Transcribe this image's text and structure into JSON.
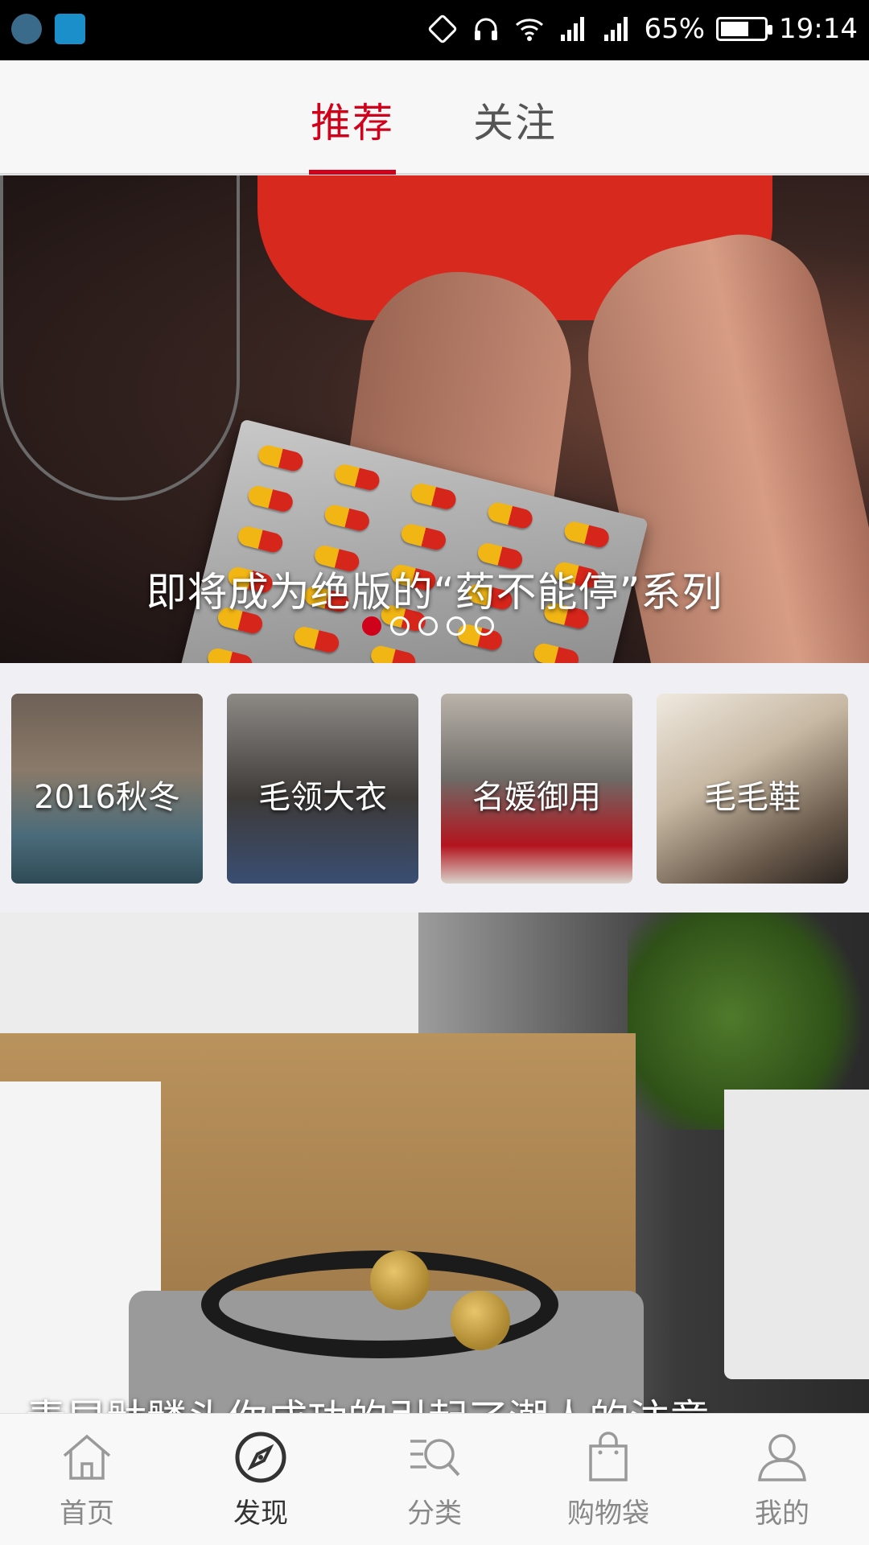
{
  "status_bar": {
    "battery": "65%",
    "time": "19:14",
    "battery_level": 0.65,
    "icons": [
      "screenshot-app-icon",
      "bull-app-icon",
      "nfc-icon",
      "headphone-icon",
      "wifi-icon",
      "signal-icon",
      "signal-icon-2",
      "battery-icon"
    ]
  },
  "tabs": [
    {
      "label": "推荐",
      "active": true
    },
    {
      "label": "关注",
      "active": false
    }
  ],
  "banner": {
    "caption": "即将成为绝版的“药不能停”系列",
    "page_count": 5,
    "active_index": 0
  },
  "categories": [
    {
      "label": "2016秋冬"
    },
    {
      "label": "毛领大衣"
    },
    {
      "label": "名媛御用"
    },
    {
      "label": "毛毛鞋"
    }
  ],
  "feature": {
    "caption": "青昆骷髅头你成功的引起了潮人的注意"
  },
  "bottom_nav": [
    {
      "label": "首页",
      "icon": "home-icon"
    },
    {
      "label": "发现",
      "icon": "compass-icon",
      "active": true
    },
    {
      "label": "分类",
      "icon": "category-search-icon"
    },
    {
      "label": "购物袋",
      "icon": "shopping-bag-icon"
    },
    {
      "label": "我的",
      "icon": "user-icon"
    }
  ],
  "colors": {
    "accent": "#d0021b",
    "nav_inactive": "#888888",
    "nav_active": "#333333"
  }
}
